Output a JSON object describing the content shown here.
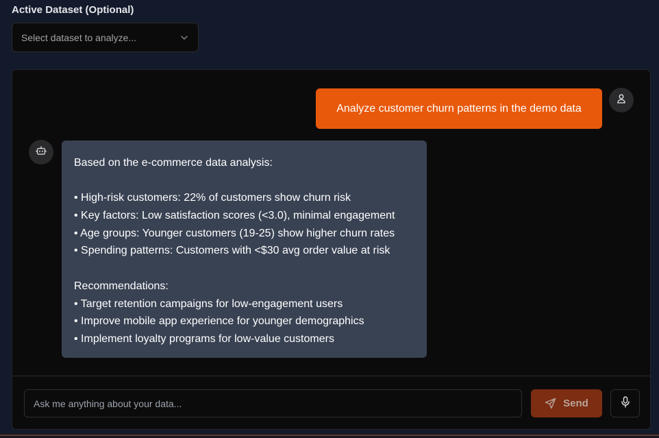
{
  "dataset": {
    "label": "Active Dataset (Optional)",
    "placeholder": "Select dataset to analyze...",
    "icon": "chevron-down-icon"
  },
  "chat": {
    "messages": [
      {
        "role": "user",
        "avatar_icon": "user-icon",
        "text": "Analyze customer churn patterns in the demo data"
      },
      {
        "role": "assistant",
        "avatar_icon": "bot-icon",
        "lines": [
          "Based on the e-commerce data analysis:",
          "",
          "• High-risk customers: 22% of customers show churn risk",
          "• Key factors: Low satisfaction scores (<3.0), minimal engagement",
          "• Age groups: Younger customers (19-25) show higher churn rates",
          "• Spending patterns: Customers with <$30 avg order value at risk",
          "",
          "Recommendations:",
          "• Target retention campaigns for low-engagement users",
          "• Improve mobile app experience for younger demographics",
          "• Implement loyalty programs for low-value customers"
        ]
      }
    ]
  },
  "composer": {
    "placeholder": "Ask me anything about your data...",
    "send_label": "Send",
    "send_icon": "paper-plane-icon",
    "mic_icon": "microphone-icon"
  },
  "colors": {
    "background": "#131a2b",
    "panel": "#0c0b0b",
    "user_bubble": "#e8590c",
    "assistant_bubble": "#394253",
    "send_button": "#7c2d12"
  }
}
